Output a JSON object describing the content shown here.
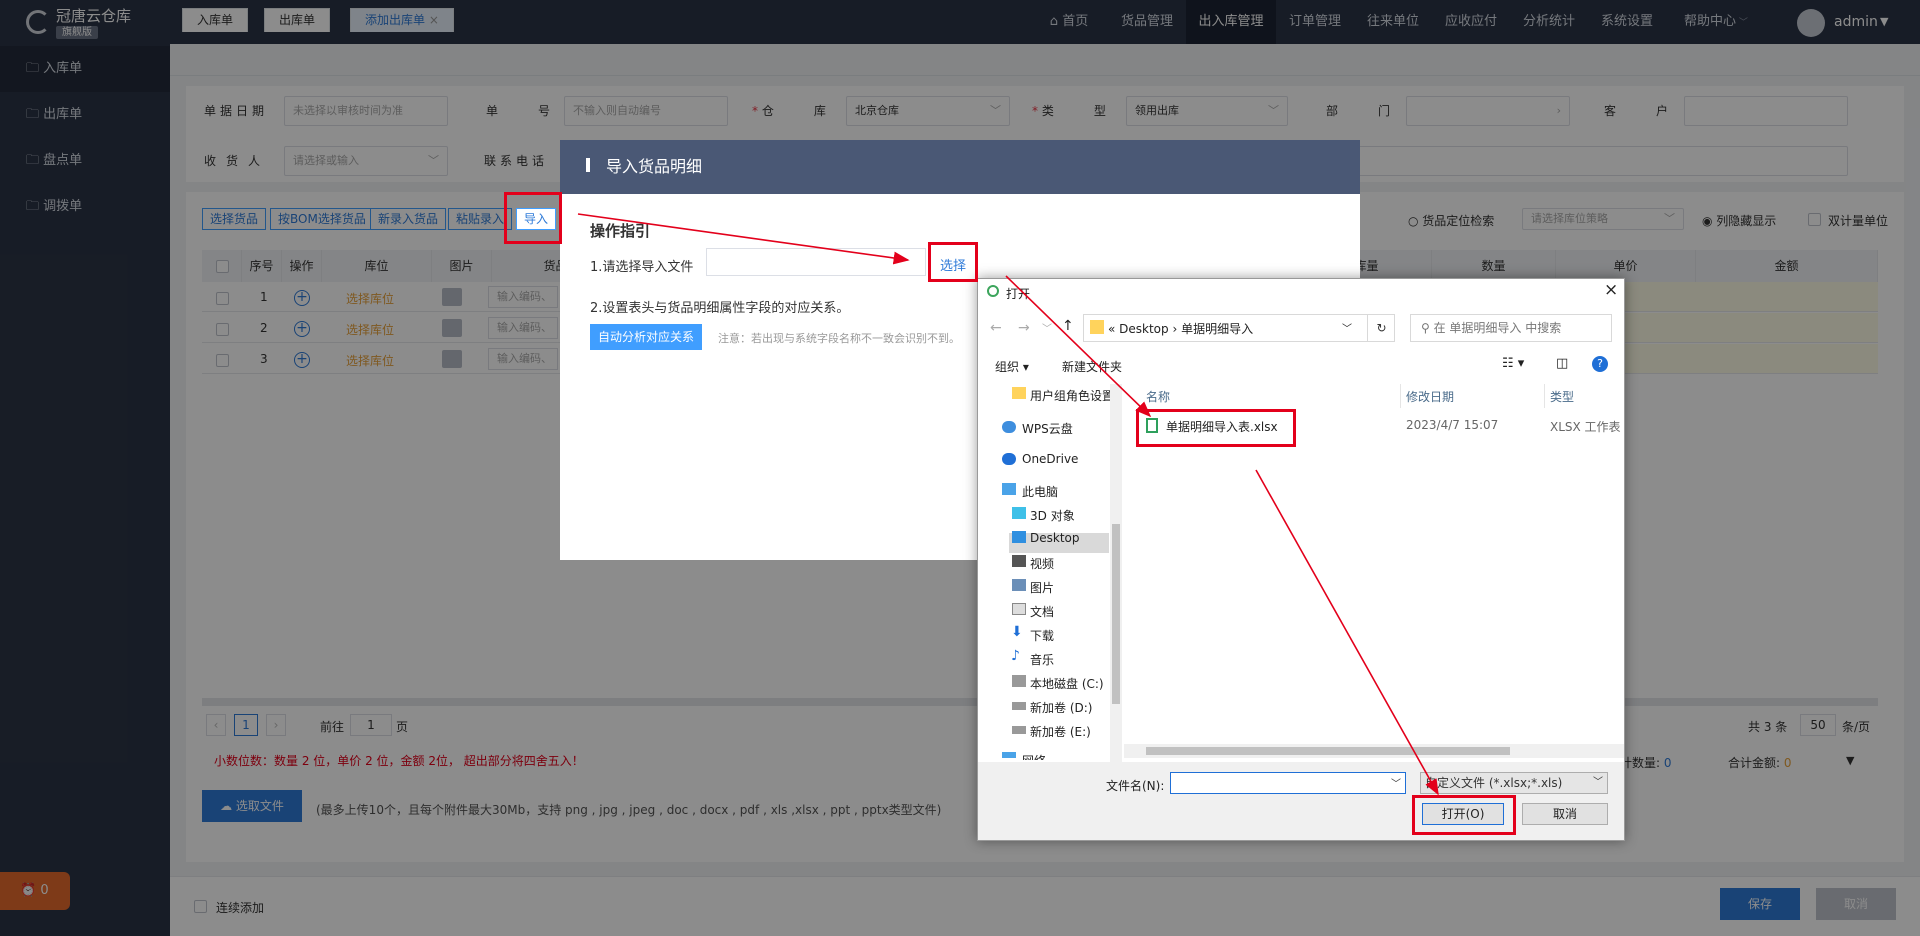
{
  "app": {
    "logo_title": "冠唐云仓库",
    "logo_badge": "旗舰版",
    "user": "admin",
    "alarm_count": "0"
  },
  "topnav": [
    "首页",
    "货品管理",
    "出入库管理",
    "订单管理",
    "往来单位",
    "应收应付",
    "分析统计",
    "系统设置",
    "帮助中心"
  ],
  "sidebar": [
    "入库单",
    "出库单",
    "盘点单",
    "调拨单"
  ],
  "tabs": [
    "入库单",
    "出库单",
    "添加出库单"
  ],
  "form": {
    "date_label": "单据日期",
    "date_ph": "未选择以审核时间为准",
    "no_label": "单号",
    "no_ph": "不输入则自动编号",
    "wh_label": "仓库",
    "wh_value": "北京仓库",
    "type_label": "类型",
    "type_value": "领用出库",
    "dept_label": "部门",
    "cust_label": "客户",
    "recv_label": "收货人",
    "recv_ph": "请选择或输入",
    "phone_label": "联系电话"
  },
  "toolbar": {
    "b1": "选择货品",
    "b2": "按BOM选择货品",
    "b3": "新录入货品",
    "b4": "粘贴录入",
    "b5": "导入",
    "locate": "货品定位检索",
    "strategy_ph": "请选择库位策略",
    "hidden": "列隐藏显示",
    "dual": "双计量单位"
  },
  "table": {
    "headers": [
      "序号",
      "操作",
      "库位",
      "图片",
      "货品编",
      "出库量",
      "数量",
      "单价",
      "金额"
    ],
    "rows": [
      "1",
      "2",
      "3"
    ],
    "loc": "选择库位",
    "code_ph": "输入编码、"
  },
  "pager": {
    "page": "1",
    "prefix": "前往",
    "suffix": "页",
    "total": "共 3 条",
    "size": "50",
    "unit": "条/页"
  },
  "tip": "小数位数：数量 2 位，单价 2 位，金额 2位， 超出部分将四舍五入！",
  "summary": {
    "qty_label": "计数量:",
    "qty": "0",
    "amt_label": "合计金额:",
    "amt": "0"
  },
  "upload": {
    "btn": "选取文件",
    "hint": "(最多上传10个，且每个附件最大30Mb，支持 png , jpg , jpeg , doc , docx , pdf , xls ,xlsx , ppt , pptx类型文件)"
  },
  "footer": {
    "continue": "连续添加",
    "save": "保存",
    "cancel": "取消"
  },
  "modal": {
    "title": "导入货品明细",
    "guide": "操作指引",
    "step1": "1.请选择导入文件",
    "choose": "选择",
    "step2": "2.设置表头与货品明细属性字段的对应关系。",
    "auto": "自动分析对应关系",
    "note": "注意：若出现与系统字段名称不一致会识别不到。"
  },
  "dialog": {
    "title": "打开",
    "path1": "Desktop",
    "path2": "单据明细导入",
    "search_ph": "在 单据明细导入 中搜索",
    "organize": "组织",
    "newfolder": "新建文件夹",
    "tree": [
      "用户组角色设置",
      "WPS云盘",
      "OneDrive",
      "此电脑",
      "3D 对象",
      "Desktop",
      "视频",
      "图片",
      "文档",
      "下载",
      "音乐",
      "本地磁盘 (C:)",
      "新加卷 (D:)",
      "新加卷 (E:)",
      "网络"
    ],
    "col_name": "名称",
    "col_date": "修改日期",
    "col_type": "类型",
    "file_name": "单据明细导入表.xlsx",
    "file_date": "2023/4/7 15:07",
    "file_type": "XLSX 工作表",
    "fname_label": "文件名(N):",
    "filter": "自定义文件 (*.xlsx;*.xls)",
    "open": "打开(O)",
    "cancel": "取消"
  },
  "colors": {
    "accent": "#2f7bd8",
    "annot": "#e3001b",
    "topbar": "#2b3446",
    "alarm": "#e56b2c"
  }
}
